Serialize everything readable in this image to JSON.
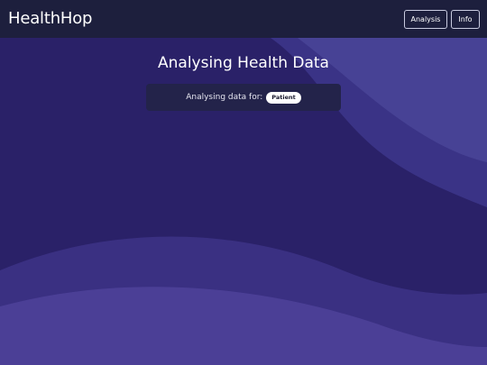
{
  "app": {
    "brand": "HealthHop"
  },
  "nav": {
    "analysis_label": "Analysis",
    "info_label": "Info"
  },
  "main": {
    "title": "Analysing Health Data",
    "card": {
      "label": "Analysing data for:",
      "patient": "Patient"
    }
  },
  "colors": {
    "navbar": "#1d1f3d",
    "background": "#2b2370",
    "card": "#23234a",
    "chip": "#ffffff"
  }
}
